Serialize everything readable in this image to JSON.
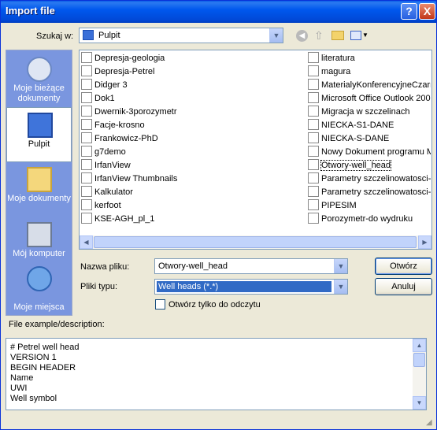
{
  "window": {
    "title": "Import file",
    "help_button": "?",
    "close_button": "X"
  },
  "lookin": {
    "label": "Szukaj w:",
    "value": "Pulpit"
  },
  "places": [
    {
      "label": "Moje bieżące dokumenty",
      "icon": "recent-documents-icon"
    },
    {
      "label": "Pulpit",
      "icon": "desktop-icon"
    },
    {
      "label": "Moje dokumenty",
      "icon": "my-documents-icon"
    },
    {
      "label": "Mój komputer",
      "icon": "my-computer-icon"
    },
    {
      "label": "Moje miejsca",
      "icon": "network-places-icon"
    }
  ],
  "files_col1": [
    "Depresja-geologia",
    "Depresja-Petrel",
    "Didger 3",
    "Dok1",
    "Dwernik-3porozymetr",
    "Facje-krosno",
    "Frankowicz-PhD",
    "g7demo",
    "IrfanView",
    "IrfanView Thumbnails",
    "Kalkulator",
    "kerfoot",
    "KSE-AGH_pl_1"
  ],
  "files_col2": [
    "literatura",
    "magura",
    "MaterialyKonferencyjneCzarr",
    "Microsoft Office Outlook 200",
    "Migracja w szczelinach",
    "NIECKA-S1-DANE",
    "NIECKA-S-DANE",
    "Nowy Dokument programu M",
    "Otwory-well_head",
    "Parametry szczelinowatosci-a",
    "Parametry szczelinowatosci-a",
    "PIPESIM",
    "Porozymetr-do wydruku"
  ],
  "filename": {
    "label": "Nazwa pliku:",
    "value": "Otwory-well_head"
  },
  "filetype": {
    "label": "Pliki typu:",
    "value": "Well heads (*.*)"
  },
  "readonly": {
    "label": "Otwórz tylko do odczytu"
  },
  "buttons": {
    "open": "Otwórz",
    "cancel": "Anuluj"
  },
  "description": {
    "label": "File example/description:",
    "lines": [
      "# Petrel well head",
      "VERSION 1",
      "BEGIN HEADER",
      "Name",
      "UWI",
      "Well symbol"
    ]
  },
  "colors": {
    "title_bar": "#0058ee",
    "places_bg": "#7a96df",
    "selection": "#316ac5"
  }
}
